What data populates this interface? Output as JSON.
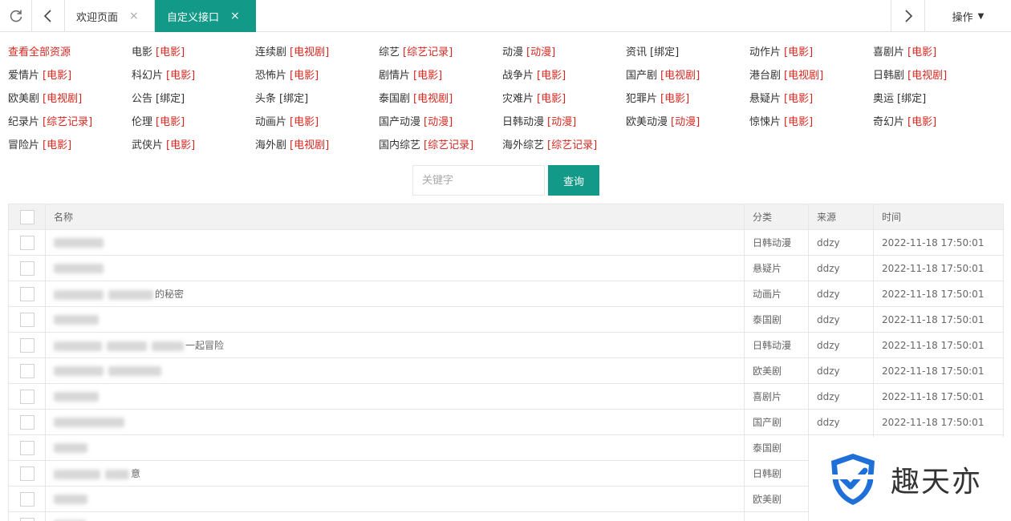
{
  "tabs": {
    "welcome": "欢迎页面",
    "active": "自定义接口",
    "close_glyph": "×",
    "operations": "操作"
  },
  "categories": [
    {
      "name": "查看全部资源",
      "type": ""
    },
    {
      "name": "电影",
      "type": "[电影]"
    },
    {
      "name": "连续剧",
      "type": "[电视剧]"
    },
    {
      "name": "综艺",
      "type": "[综艺记录]"
    },
    {
      "name": "动漫",
      "type": "[动漫]"
    },
    {
      "name": "资讯",
      "type": "[绑定]"
    },
    {
      "name": "动作片",
      "type": "[电影]"
    },
    {
      "name": "喜剧片",
      "type": "[电影]"
    },
    {
      "name": "爱情片",
      "type": "[电影]"
    },
    {
      "name": "科幻片",
      "type": "[电影]"
    },
    {
      "name": "恐怖片",
      "type": "[电影]"
    },
    {
      "name": "剧情片",
      "type": "[电影]"
    },
    {
      "name": "战争片",
      "type": "[电影]"
    },
    {
      "name": "国产剧",
      "type": "[电视剧]"
    },
    {
      "name": "港台剧",
      "type": "[电视剧]"
    },
    {
      "name": "日韩剧",
      "type": "[电视剧]"
    },
    {
      "name": "欧美剧",
      "type": "[电视剧]"
    },
    {
      "name": "公告",
      "type": "[绑定]"
    },
    {
      "name": "头条",
      "type": "[绑定]"
    },
    {
      "name": "泰国剧",
      "type": "[电视剧]"
    },
    {
      "name": "灾难片",
      "type": "[电影]"
    },
    {
      "name": "犯罪片",
      "type": "[电影]"
    },
    {
      "name": "悬疑片",
      "type": "[电影]"
    },
    {
      "name": "奥运",
      "type": "[绑定]"
    },
    {
      "name": "纪录片",
      "type": "[综艺记录]"
    },
    {
      "name": "伦理",
      "type": "[电影]"
    },
    {
      "name": "动画片",
      "type": "[电影]"
    },
    {
      "name": "国产动漫",
      "type": "[动漫]"
    },
    {
      "name": "日韩动漫",
      "type": "[动漫]"
    },
    {
      "name": "欧美动漫",
      "type": "[动漫]"
    },
    {
      "name": "惊悚片",
      "type": "[电影]"
    },
    {
      "name": "奇幻片",
      "type": "[电影]"
    },
    {
      "name": "冒险片",
      "type": "[电影]"
    },
    {
      "name": "武侠片",
      "type": "[电影]"
    },
    {
      "name": "海外剧",
      "type": "[电视剧]"
    },
    {
      "name": "国内综艺",
      "type": "[综艺记录]"
    },
    {
      "name": "海外综艺",
      "type": "[综艺记录]"
    }
  ],
  "search": {
    "placeholder": "关键字",
    "button": "查询"
  },
  "table": {
    "headers": [
      "名称",
      "分类",
      "来源",
      "时间"
    ],
    "rows": [
      {
        "name": "",
        "category": "日韩动漫",
        "source": "ddzy",
        "time": "2022-11-18 17:50:01"
      },
      {
        "name": "",
        "category": "悬疑片",
        "source": "ddzy",
        "time": "2022-11-18 17:50:01"
      },
      {
        "name": "的秘密",
        "category": "动画片",
        "source": "ddzy",
        "time": "2022-11-18 17:50:01"
      },
      {
        "name": "",
        "category": "泰国剧",
        "source": "ddzy",
        "time": "2022-11-18 17:50:01"
      },
      {
        "name": "一起冒险",
        "category": "日韩动漫",
        "source": "ddzy",
        "time": "2022-11-18 17:50:01"
      },
      {
        "name": "",
        "category": "欧美剧",
        "source": "ddzy",
        "time": "2022-11-18 17:50:01"
      },
      {
        "name": "",
        "category": "喜剧片",
        "source": "ddzy",
        "time": "2022-11-18 17:50:01"
      },
      {
        "name": "",
        "category": "国产剧",
        "source": "ddzy",
        "time": "2022-11-18 17:50:01"
      },
      {
        "name": "",
        "category": "泰国剧",
        "source": "",
        "time": ""
      },
      {
        "name": "意",
        "category": "日韩剧",
        "source": "",
        "time": ""
      },
      {
        "name": "",
        "category": "欧美剧",
        "source": "",
        "time": ""
      },
      {
        "name": "",
        "category": "",
        "source": "",
        "time": ""
      }
    ]
  },
  "watermark": {
    "text": "趣天亦"
  },
  "colors": {
    "accent": "#129988",
    "link_red": "#d6271f",
    "header_bg": "#f2f2f2",
    "border": "#e6e6e6"
  }
}
